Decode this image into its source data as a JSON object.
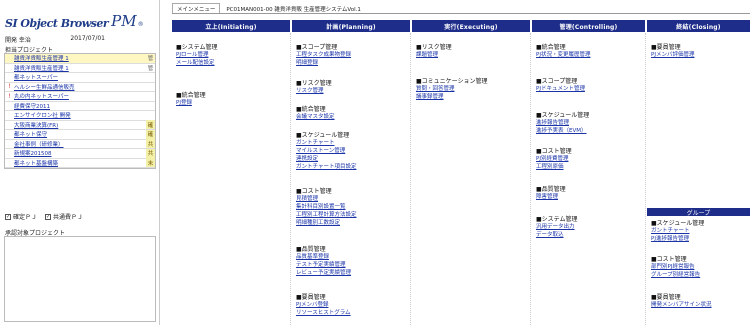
{
  "left": {
    "logo": {
      "main": "SI Object Browser",
      "pm": "PM",
      "suffix": "®"
    },
    "user_name": "開発 幸治",
    "date": "2017/07/01",
    "projects_title": "担当プロジェクト",
    "projects": [
      {
        "name": "雑貨洋貨販生産管理 1",
        "icon": "",
        "badge": "管",
        "selected": true
      },
      {
        "name": "雑貨洋貨販生産管理 1",
        "icon": "",
        "badge": "管",
        "selected": false
      },
      {
        "name": "都ネットスーパー",
        "icon": "",
        "badge": "",
        "selected": false
      },
      {
        "name": "ヘルシー生鮮品通信販売",
        "icon": "!",
        "badge": "",
        "selected": false
      },
      {
        "name": "丸の内ネットスーパー",
        "icon": "!",
        "badge": "",
        "selected": false
      },
      {
        "name": "経費保守2011",
        "icon": "",
        "badge": "",
        "selected": false
      },
      {
        "name": "エンサイクロン社 開発",
        "icon": "",
        "badge": "",
        "selected": false
      },
      {
        "name": "大阪商業決算(FR)",
        "icon": "",
        "badge": "確",
        "selected": false
      },
      {
        "name": "都ネット保守",
        "icon": "",
        "badge": "確",
        "selected": false
      },
      {
        "name": "金社事例（研修業）",
        "icon": "",
        "badge": "共",
        "selected": false
      },
      {
        "name": "新規案201508",
        "icon": "",
        "badge": "共",
        "selected": false
      },
      {
        "name": "都ネット基盤構築",
        "icon": "",
        "badge": "未",
        "selected": false
      }
    ],
    "check_confirmed": "確定ＰＪ",
    "check_shared": "共通費ＰＪ",
    "approval_title": "承認対象プロジェクト"
  },
  "header": {
    "tab_menu": "メインメニュー",
    "breadcrumb": "PC01MAN001-00 雑貨洋貨販 生産管理システムVol.1"
  },
  "columns": [
    {
      "title": "立上(Initiating)",
      "groups": [
        {
          "title": "■システム管理",
          "links": [
            "PJロール管理",
            "メール配信設定"
          ]
        },
        {
          "title": "■統合管理",
          "links": [
            "PJ登録"
          ]
        }
      ]
    },
    {
      "title": "計画(Planning)",
      "groups": [
        {
          "title": "■スコープ管理",
          "links": [
            "工程タスク成果物登録",
            "明細登録"
          ]
        },
        {
          "title": "■リスク管理",
          "links": [
            "リスク管理"
          ]
        },
        {
          "title": "■統合管理",
          "links": [
            "会議マスタ設定"
          ]
        },
        {
          "title": "■スケジュール管理",
          "links": [
            "ガントチャート",
            "マイルストーン管理",
            "連携設定",
            "ガントチャート項目設定"
          ]
        },
        {
          "title": "■コスト管理",
          "links": [
            "見積管理",
            "集計科目別設置一覧",
            "工程別工程計算方法設定",
            "明細種別工数設定"
          ]
        },
        {
          "title": "■品質管理",
          "links": [
            "品質基準登録",
            "テスト予定実績管理",
            "レビュー予定実績管理"
          ]
        },
        {
          "title": "■要員管理",
          "links": [
            "PJメンバ登録",
            "リソースヒストグラム"
          ]
        }
      ]
    },
    {
      "title": "実行(Executing)",
      "groups": [
        {
          "title": "■リスク管理",
          "links": [
            "課題管理"
          ]
        },
        {
          "title": "■コミュニケーション管理",
          "links": [
            "質問・回答管理",
            "議事録管理"
          ]
        }
      ]
    },
    {
      "title": "管理(Controlling)",
      "groups": [
        {
          "title": "■統合管理",
          "links": [
            "PJ状況・変更履歴管理"
          ]
        },
        {
          "title": "■スコープ管理",
          "links": [
            "PJドキュメント管理"
          ]
        },
        {
          "title": "■スケジュール管理",
          "links": [
            "進捗報告管理",
            "進捗予実表（EVM）"
          ]
        },
        {
          "title": "■コスト管理",
          "links": [
            "PJ別経費管理",
            "工程別原価"
          ]
        },
        {
          "title": "■品質管理",
          "links": [
            "障害管理"
          ]
        },
        {
          "title": "■システム管理",
          "links": [
            "汎用データ出力",
            "データ取込"
          ]
        }
      ]
    },
    {
      "title": "終結(Closing)",
      "groups": [
        {
          "title": "■要員管理",
          "links": [
            "PJメンバ評価管理"
          ]
        }
      ],
      "group_bar": "グループ",
      "group_groups": [
        {
          "title": "■スケジュール管理",
          "links": [
            "ガントチャート",
            "PJ進捗報告管理"
          ]
        },
        {
          "title": "■コスト管理",
          "links": [
            "部門別PJ経営報告",
            "グループ別経営報告"
          ]
        },
        {
          "title": "■要員管理",
          "links": [
            "開発メンバアサイン状況"
          ]
        }
      ]
    }
  ]
}
